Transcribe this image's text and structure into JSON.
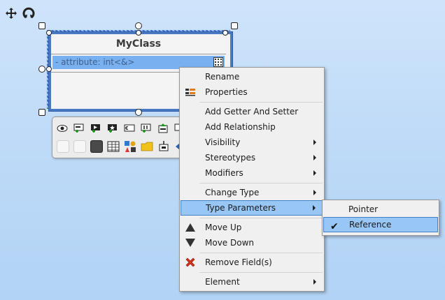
{
  "class_box": {
    "name": "MyClass",
    "attribute": "- attribute: int<&>"
  },
  "context_menu": {
    "items": [
      {
        "label": "Rename"
      },
      {
        "label": "Properties"
      },
      {
        "label": "Add Getter And Setter"
      },
      {
        "label": "Add Relationship"
      },
      {
        "label": "Visibility"
      },
      {
        "label": "Stereotypes"
      },
      {
        "label": "Modifiers"
      },
      {
        "label": "Change Type"
      },
      {
        "label": "Type Parameters"
      },
      {
        "label": "Move Up"
      },
      {
        "label": "Move Down"
      },
      {
        "label": "Remove Field(s)"
      },
      {
        "label": "Element"
      }
    ]
  },
  "submenu": {
    "items": [
      {
        "label": "Pointer"
      },
      {
        "label": "Reference"
      }
    ],
    "checked_mark": "✔"
  },
  "colors": {
    "highlight": "#99c7f5",
    "highlight_border": "#3d7fc8",
    "selection": "#4a79c3",
    "attr_row": "#79b1f0"
  }
}
